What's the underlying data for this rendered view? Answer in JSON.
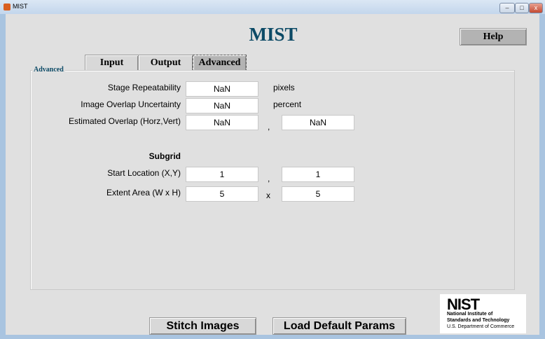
{
  "window": {
    "title": "MIST",
    "minimize": "–",
    "maximize": "□",
    "close": "x"
  },
  "app_title": "MIST",
  "help_label": "Help",
  "tabs": [
    {
      "label": "Input"
    },
    {
      "label": "Output"
    },
    {
      "label": "Advanced",
      "active": true
    }
  ],
  "panel_label": "Advanced",
  "fields": {
    "stage_repeatability": {
      "label": "Stage Repeatability",
      "value": "NaN",
      "unit": "pixels"
    },
    "overlap_uncertainty": {
      "label": "Image Overlap Uncertainty",
      "value": "NaN",
      "unit": "percent"
    },
    "estimated_overlap": {
      "label": "Estimated Overlap (Horz,Vert)",
      "horz": "NaN",
      "vert": "NaN",
      "sep": ","
    }
  },
  "subgrid": {
    "heading": "Subgrid",
    "start": {
      "label": "Start Location (X,Y)",
      "x": "1",
      "y": "1",
      "sep": ","
    },
    "extent": {
      "label": "Extent Area (W x H)",
      "w": "5",
      "h": "5",
      "sep": "x"
    }
  },
  "buttons": {
    "stitch": "Stitch Images",
    "load_defaults": "Load Default Params"
  },
  "logo": {
    "mark": "NIST",
    "line1": "National Institute of",
    "line2": "Standards and Technology",
    "line3": "U.S. Department of Commerce"
  }
}
